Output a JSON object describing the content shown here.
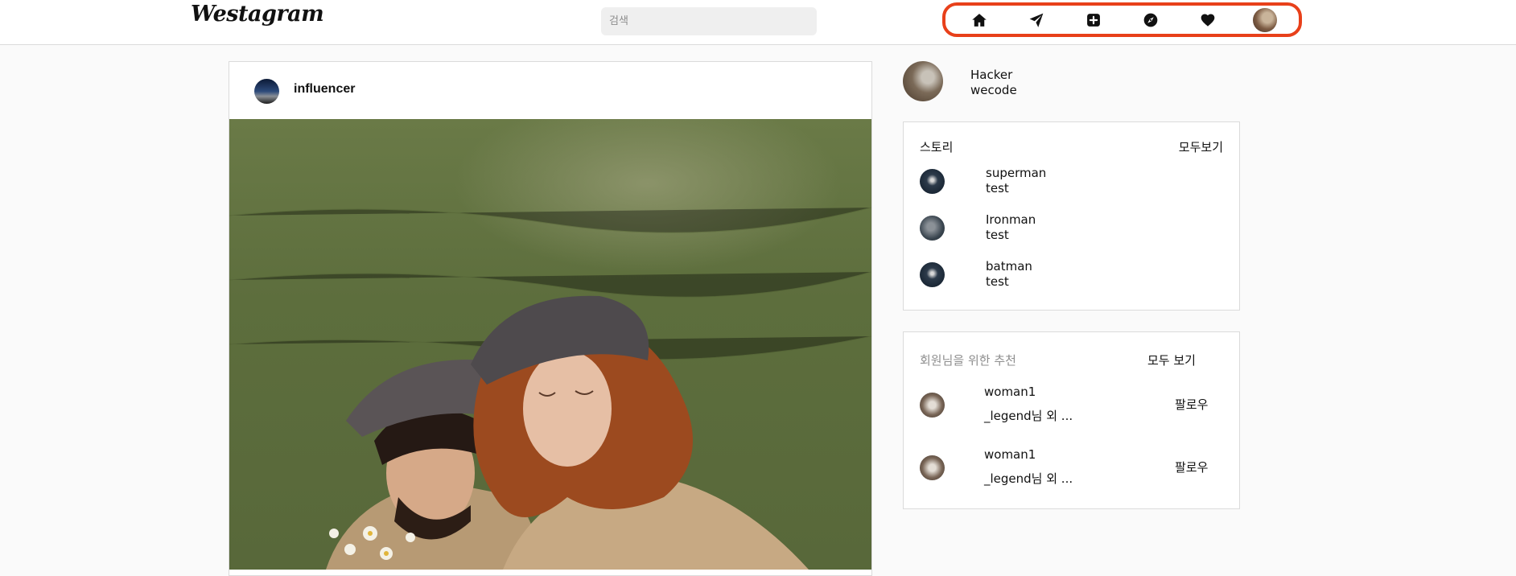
{
  "nav": {
    "logo": "Westagram",
    "search_placeholder": "검색",
    "icons": [
      "home-icon",
      "paper-plane-icon",
      "plus-square-icon",
      "compass-icon",
      "heart-icon",
      "profile-avatar"
    ],
    "highlight_color": "#e8401a"
  },
  "post": {
    "username": "influencer"
  },
  "profile": {
    "name": "Hacker",
    "subtitle": "wecode"
  },
  "stories": {
    "title": "스토리",
    "see_all": "모두보기",
    "items": [
      {
        "name": "superman",
        "sub": "test"
      },
      {
        "name": "Ironman",
        "sub": "test"
      },
      {
        "name": "batman",
        "sub": "test"
      }
    ]
  },
  "recommendations": {
    "title": "회원님을 위한 추천",
    "see_all": "모두 보기",
    "items": [
      {
        "name": "woman1",
        "sub": "_legend님 외 ...",
        "action": "팔로우"
      },
      {
        "name": "woman1",
        "sub": "_legend님 외 ...",
        "action": "팔로우"
      }
    ]
  }
}
